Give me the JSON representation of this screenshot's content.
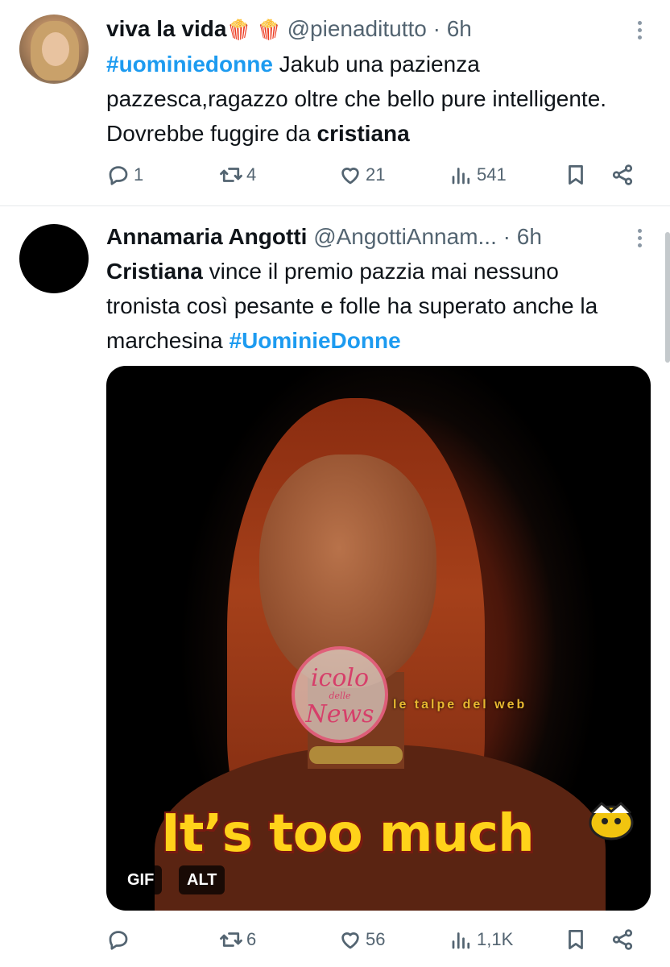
{
  "tweets": [
    {
      "name": "viva la vida",
      "name_emoji": "🍿 🍿",
      "handle": "@pienaditutto",
      "separator": "·",
      "time": "6h",
      "text": {
        "hashtag": "#uominiedonne",
        "part1": " Jakub una pazienza pazzesca,ragazzo oltre che bello pure intelligente. Dovrebbe fuggire da ",
        "bold": "cristiana"
      },
      "actions": {
        "replies": "1",
        "reposts": "4",
        "likes": "21",
        "views": "541"
      }
    },
    {
      "name": "Annamaria Angotti",
      "handle": "@AngottiAnnam...",
      "separator": "·",
      "time": "6h",
      "text": {
        "bold": "Cristiana",
        "part1": " vince il premio pazzia mai nessuno tronista così pesante e folle ha superato anche la marchesina ",
        "hashtag": "#UominieDonne"
      },
      "media": {
        "caption": "It’s too much",
        "badge_gif": "GIF",
        "badge_alt": "ALT",
        "watermark_top": "icolo",
        "watermark_mid": "delle",
        "watermark_bottom": "News",
        "watermark_text": "le talpe del web"
      },
      "actions": {
        "replies": "",
        "reposts": "6",
        "likes": "56",
        "views": "1,1K"
      }
    }
  ],
  "icons": [
    "reply-icon",
    "repost-icon",
    "like-icon",
    "views-icon",
    "bookmark-icon",
    "share-icon",
    "more-icon"
  ],
  "colors": {
    "accent": "#1d9bf0",
    "secondary_text": "#536471",
    "primary_text": "#0f1419",
    "caption": "#ffd21a"
  }
}
